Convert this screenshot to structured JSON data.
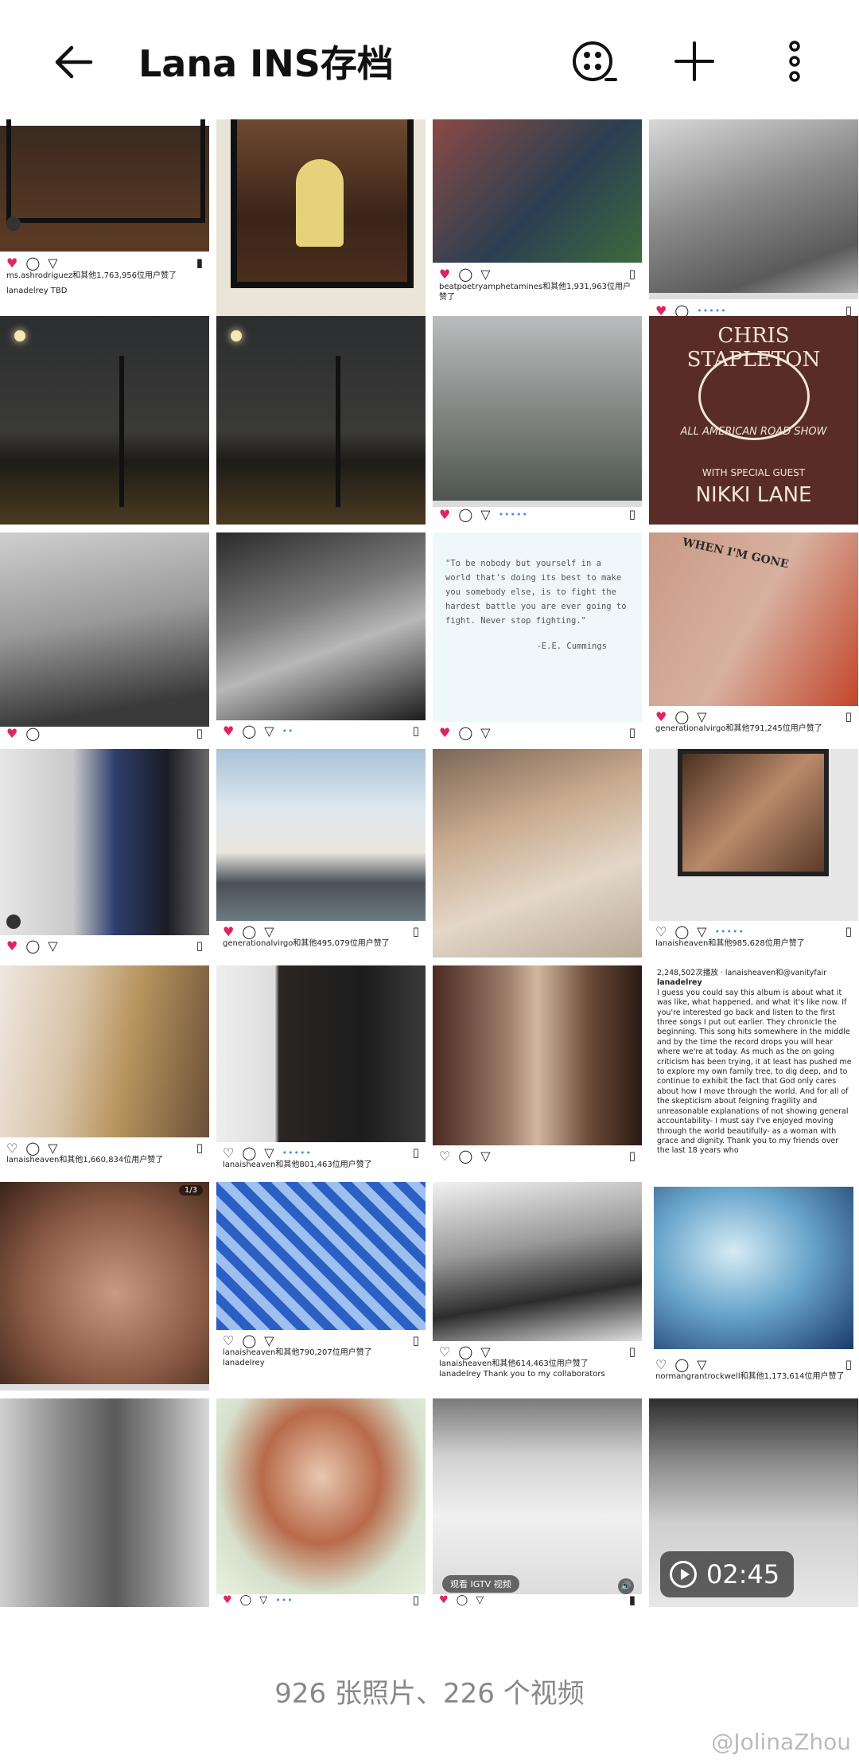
{
  "header": {
    "title": "Lana INS存档"
  },
  "posts": {
    "p1": {
      "liker": "ms.ashrodriguez和其他1,763,956位用户赞了",
      "caption": "lanadelrey TBD"
    },
    "p3": {
      "liker": "beatpoetryamphetamines和其他1,931,963位用户赞了"
    },
    "p8": {
      "poster_line1": "CHRIS STAPLETON",
      "poster_line2": "ALL AMERICAN ROAD SHOW",
      "poster_line3": "WITH SPECIAL GUEST",
      "poster_line4": "NIKKI LANE"
    },
    "p11": {
      "quote": "\"To be nobody but yourself in a world that's doing its best to make you somebody else, is to fight the hardest battle you are ever going to fight. Never stop fighting.\"",
      "author": "-E.E. Cummings"
    },
    "p12": {
      "tattoo": "WHEN I'M GONE",
      "liker": "generationalvirgo和其他791,245位用户赞了"
    },
    "p14": {
      "liker": "generationalvirgo和其他495,079位用户赞了"
    },
    "p16": {
      "liker": "lanaisheaven和其他985,628位用户赞了"
    },
    "p17": {
      "liker": "lanaisheaven和其他1,660,834位用户赞了"
    },
    "p18": {
      "liker": "lanaisheaven和其他801,463位用户赞了"
    },
    "p20": {
      "top": "2,248,502次播放 · lanaisheaven和@vanityfair",
      "user": "lanadelrey",
      "body": "I guess you could say this album is about what it was like, what happened, and what it's like now. If you're interested go back and listen to the first three songs I put out earlier. They chronicle the beginning. This song hits somewhere in the middle and by the time the record drops you will hear where we're at today. As much as the on going criticism has been trying, it at least has pushed me to explore my own family tree, to dig deep, and to continue to exhibit the fact that God only cares about how I move through the world. And for all of the skepticism about feigning fragility and unreasonable explanations of not showing general accountability- I must say I've enjoyed moving through the world beautifully- as a woman with grace and dignity. Thank you to my friends over the last 18 years who"
    },
    "p21": {
      "badge": "1/3"
    },
    "p22": {
      "liker": "lanaisheaven和其他790,207位用户赞了",
      "caption": "lanadelrey"
    },
    "p23": {
      "liker": "lanaisheaven和其他614,463位用户赞了",
      "caption": "lanadelrey Thank you to my collaborators"
    },
    "p24": {
      "liker": "normangrantrockwell和其他1,173,614位用户赞了"
    },
    "p27": {
      "igtv": "观看 IGTV 视频"
    },
    "p28": {
      "duration": "02:45"
    }
  },
  "footer": {
    "summary": "926 张照片、226 个视频"
  },
  "watermark": "@JolinaZhou",
  "colors": {
    "heart": "#e0245e",
    "link_blue": "#4a90e2"
  }
}
